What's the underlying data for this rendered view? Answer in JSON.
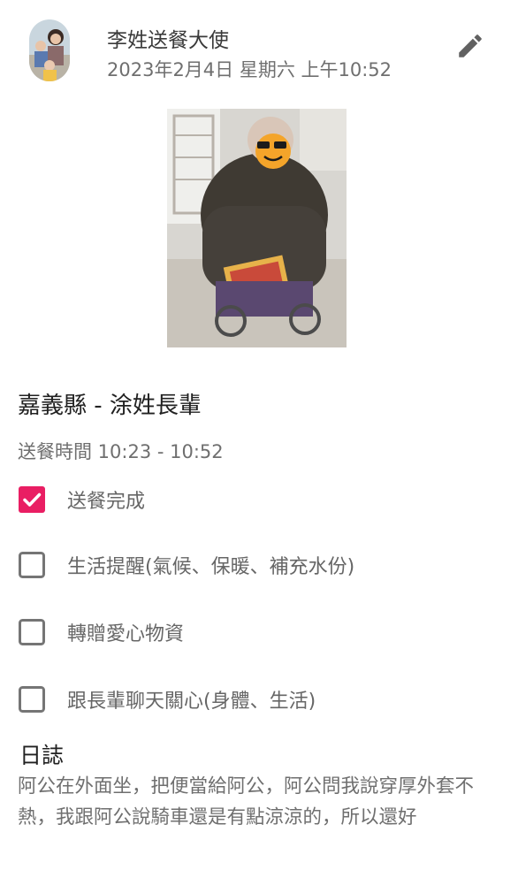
{
  "header": {
    "author": "李姓送餐大使",
    "date": "2023年2月4日 星期六 上午10:52",
    "edit_icon": "pencil-icon"
  },
  "post": {
    "title": "嘉義縣 - 涂姓長輩",
    "delivery_time": "送餐時間 10:23 - 10:52"
  },
  "checklist": [
    {
      "label": "送餐完成",
      "checked": true
    },
    {
      "label": "生活提醒(氣候、保暖、補充水份)",
      "checked": false
    },
    {
      "label": "轉贈愛心物資",
      "checked": false
    },
    {
      "label": "跟長輩聊天關心(身體、生活)",
      "checked": false
    }
  ],
  "log": {
    "title": "日誌",
    "body": "阿公在外面坐，把便當給阿公，阿公問我說穿厚外套不熱，我跟阿公說騎車還是有點涼涼的，所以還好"
  },
  "colors": {
    "checkbox_checked": "#e91e63",
    "checkbox_unchecked": "#757575"
  }
}
